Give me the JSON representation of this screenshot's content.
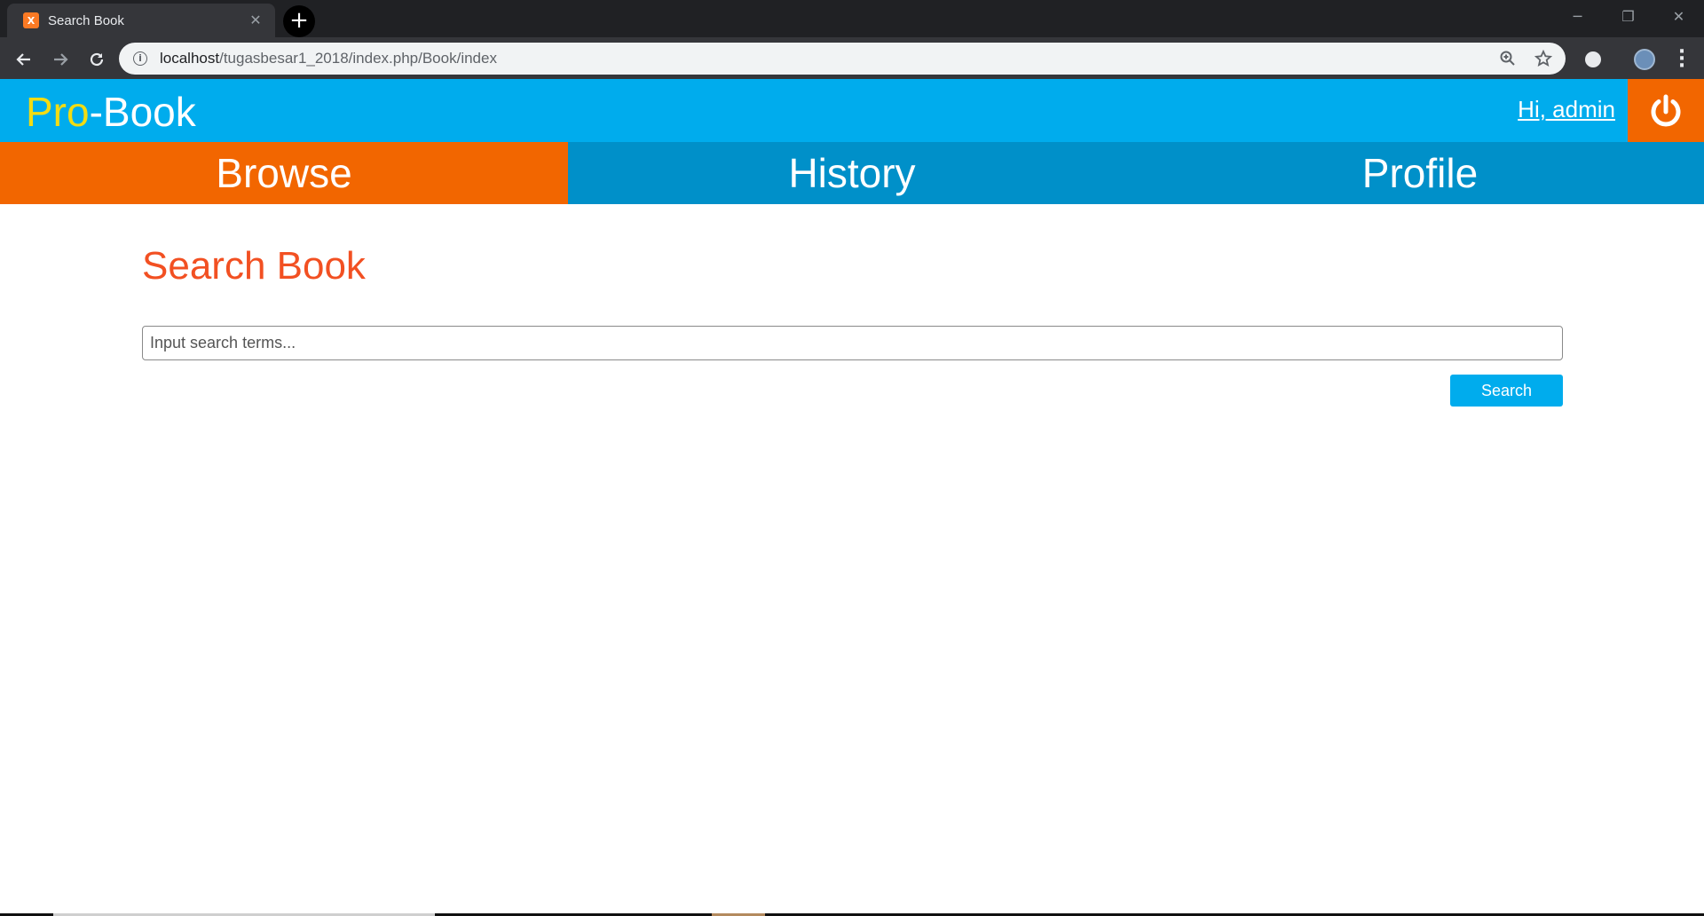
{
  "browser": {
    "tab_title": "Search Book",
    "url_host": "localhost",
    "url_path": "/tugasbesar1_2018/index.php/Book/index"
  },
  "header": {
    "logo_prefix": "Pro",
    "logo_suffix": "-Book",
    "greeting": "Hi, admin",
    "colors": {
      "header_bg": "#00aced",
      "logo_accent": "#f2dc13",
      "logout_bg": "#f26600"
    }
  },
  "nav": {
    "items": [
      {
        "label": "Browse",
        "active": true
      },
      {
        "label": "History",
        "active": false
      },
      {
        "label": "Profile",
        "active": false
      }
    ],
    "colors": {
      "bg": "#0090c9",
      "active_bg": "#f26600"
    }
  },
  "main": {
    "title": "Search Book",
    "search_placeholder": "Input search terms...",
    "search_value": "",
    "search_button": "Search",
    "colors": {
      "title": "#f25022",
      "button": "#00aced"
    }
  },
  "icons": {
    "tab_favicon": "xampp-icon",
    "back": "arrow-left-icon",
    "forward": "arrow-right-icon",
    "reload": "reload-icon",
    "site_info": "info-icon",
    "zoom": "zoom-icon",
    "bookmark": "star-icon",
    "logout": "power-icon"
  }
}
